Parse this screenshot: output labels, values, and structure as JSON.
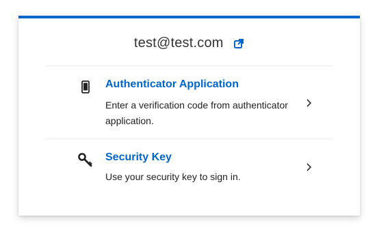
{
  "header": {
    "username": "test@test.com",
    "reset_icon": "external-link-icon",
    "accent_color": "#0066cc"
  },
  "methods": [
    {
      "title": "Authenticator Application",
      "description": "Enter a verification code from authenticator application.",
      "icon": "mobile-phone-icon"
    },
    {
      "title": "Security Key",
      "description": "Use your security key to sign in.",
      "icon": "key-icon"
    }
  ]
}
